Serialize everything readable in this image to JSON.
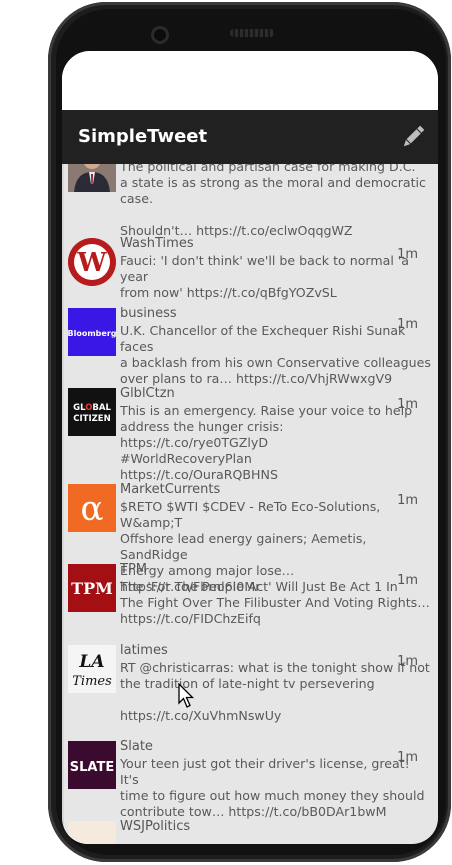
{
  "app": {
    "title": "SimpleTweet"
  },
  "colors": {
    "appbar": "#212121",
    "timeline_bg": "#e6e6e6",
    "text": "#595959"
  },
  "icons": {
    "compose": "pencil-icon"
  },
  "tweets": [
    {
      "handle": "",
      "time": "",
      "body": "The political and partisan case for making D.C.\na state is as strong as the moral and democratic\ncase.\n\nShouldn't… https://t.co/eclwOqqgWZ",
      "avatar": "person-photo"
    },
    {
      "handle": "WashTimes",
      "time": "1m",
      "body": "Fauci: 'I don't think' we'll be back to normal 'a year\nfrom now' https://t.co/qBfgYOZvSL",
      "avatar": "W"
    },
    {
      "handle": "business",
      "time": "1m",
      "body": "U.K. Chancellor of the Exchequer Rishi Sunak faces\na backlash from his own Conservative colleagues\nover plans to ra… https://t.co/VhjRWwxgV9",
      "avatar": "Bloomberg"
    },
    {
      "handle": "GlblCtzn",
      "time": "1m",
      "body": "This is an emergency. Raise your voice to help\naddress the hunger crisis: https://t.co/rye0TGZlyD\n#WorldRecoveryPlan\nhttps://t.co/OuraRQBHNS",
      "avatar": "GLOBAL CITIZEN"
    },
    {
      "handle": "MarketCurrents",
      "time": "1m",
      "body": "$RETO $WTI $CDEV - ReTo Eco-Solutions, W&amp;T\nOffshore lead energy gainers; Aemetis, SandRidge\nEnergy among major lose… https://t.co/Fbrnl6I0Mr",
      "avatar": "α"
    },
    {
      "handle": "TPM",
      "time": "1m",
      "body": "The 'For The People Act' Will Just Be Act 1 In\nThe Fight Over The Filibuster And Voting Rights…\nhttps://t.co/FIDChzEifq",
      "avatar": "TPM"
    },
    {
      "handle": "latimes",
      "time": "1m",
      "body": "RT @christicarras: what is the tonight show if not\nthe tradition of late-night tv persevering\n\nhttps://t.co/XuVhmNswUy",
      "avatar": "LA Times"
    },
    {
      "handle": "Slate",
      "time": "1m",
      "body": "Your teen just got their driver's license, great! It's\ntime to figure out how much money they should\ncontribute tow… https://t.co/bB0DAr1bwM",
      "avatar": "SLATE"
    },
    {
      "handle": "WSJPolitics",
      "time": "",
      "body": "",
      "avatar": ""
    }
  ]
}
